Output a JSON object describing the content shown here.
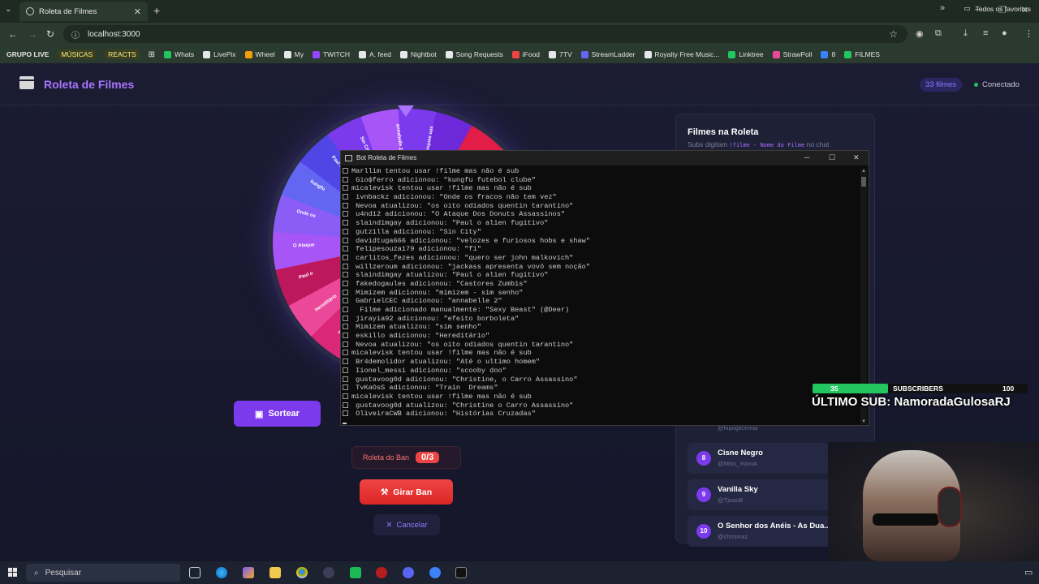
{
  "browser": {
    "tab_title": "Roleta de Filmes",
    "url": "localhost:3000",
    "bookmarks": [
      {
        "label": "GRUPO LIVE",
        "style": "bold"
      },
      {
        "label": "MÚSICAS",
        "style": "yellow"
      },
      {
        "label": "REACTS",
        "style": "yellow"
      },
      {
        "label": "",
        "style": "grid"
      },
      {
        "label": "Whats",
        "color": "#22c55e"
      },
      {
        "label": "LivePix",
        "color": "#e5e7eb"
      },
      {
        "label": "Wheel",
        "color": "#f59e0b"
      },
      {
        "label": "My",
        "color": "#e5e7eb"
      },
      {
        "label": "TWITCH",
        "color": "#9146ff"
      },
      {
        "label": "A. feed",
        "color": "#e5e7eb"
      },
      {
        "label": "Nightbot",
        "color": "#e5e7eb"
      },
      {
        "label": "Song Requests",
        "color": "#e5e7eb"
      },
      {
        "label": "iFood",
        "color": "#ef4444"
      },
      {
        "label": "7TV",
        "color": "#e5e7eb"
      },
      {
        "label": "StreamLadder",
        "color": "#6366f1"
      },
      {
        "label": "Royalty Free Music...",
        "color": "#e5e7eb"
      },
      {
        "label": "Linktree",
        "color": "#22c55e"
      },
      {
        "label": "StrawPoll",
        "color": "#ec4899"
      },
      {
        "label": "8",
        "color": "#3b82f6"
      },
      {
        "label": "FILMES",
        "color": "#22c55e"
      }
    ],
    "all_bookmarks": "Todos os favoritos"
  },
  "app": {
    "title": "Roleta de Filmes",
    "film_count": "33 filmes",
    "status": "Conectado",
    "sortear_label": "Sortear",
    "ban_label": "Roleta do Ban",
    "ban_count": "0/3",
    "girar_ban_label": "Girar Ban",
    "cancel_label": "Cancelar",
    "wheel_labels": [
      "sim senho",
      "annabelle 2",
      "Sin City",
      "Paul o",
      "kungfu",
      "Onde os",
      "O Ataque",
      "Paul o",
      "Hereditário",
      "o ultimo",
      "Sexy Beast",
      "scooby doo"
    ],
    "panel": {
      "title": "Filmes na Roleta",
      "subtitle_prefix": "Subs digitam",
      "command": "!filme - Nome do Filme",
      "subtitle_suffix": "no chat",
      "partial_user": "@hipoglicemia",
      "films": [
        {
          "num": "8",
          "name": "Cisne Negro",
          "user": "@Miss_YoonA"
        },
        {
          "num": "9",
          "name": "Vanilla Sky",
          "user": "@TjoaoB"
        },
        {
          "num": "10",
          "name": "O Senhor dos Anéis - As Dua...",
          "user": "@chrismxz"
        }
      ]
    }
  },
  "console": {
    "title": "Bot Roleta de Filmes",
    "lines": [
      "Marllim tentou usar !filme mas não é sub",
      " Gioфferro adicionou: \"kungfu futebol clube\"",
      "micalevisk tentou usar !filme mas não é sub",
      " ivnbackz adicionou: \"Onde os fracos não tem vez\"",
      " Nevoa atualizou: \"os oito odiados quentin tarantino\"",
      " u4nd12 adicionou: \"O Ataque Dos Donuts Assassinos\"",
      " slaindimgay adicionou: \"Paul o alien fugitivo\"",
      " gutz1lla adicionou: \"Sin City\"",
      " davidtuga666 adicionou: \"velozes e furiosos hobs e shaw\"",
      " felipesouza179 adicionou: \"f1\"",
      " carlitos_fezes adicionou: \"quero ser john malkovich\"",
      " willzeroum adicionou: \"jackass apresenta vovó sem noção\"",
      " slaindimgay atualizou: \"Paul o alien fugitivo\"",
      " fakedogaules adicionou: \"Castores Zumbis\"",
      " Mimizem adicionou: \"mimizem - sim senho\"",
      " GabrielCEC adicionou: \"annabelle 2\"",
      "  Filme adicionado manualmente: \"Sexy Beast\" (@Deer)",
      " jirayia92 adicionou: \"efeito borboleta\"",
      " Mimizem atualizou: \"sim senho\"",
      " eskillo adicionou: \"Hereditário\"",
      " Nevoa atualizou: \"os oito odiados quentin tarantino\"",
      "micalevisk tentou usar !filme mas não é sub",
      " Br4demolidor atualizou: \"Até o ultimo homem\"",
      " Iionel_messi adicionou: \"scooby doo\"",
      " gustavoog0d adicionou: \"Christine, o Carro Assassino\"",
      " TvKaOsS adicionou: \"Train  Dreams\"",
      "micalevisk tentou usar !filme mas não é sub",
      " gustavoog0d atualizou: \"Christine o Carro Assassino\"",
      " OliveiraCWB adicionou: \"Histórias Cruzadas\""
    ]
  },
  "overlay": {
    "sub_current": "35",
    "sub_label": "SUBSCRIBERS",
    "sub_goal": "100",
    "sub_progress": 0.35,
    "last_sub": "ÚLTIMO SUB: NamoradaGulosaRJ"
  },
  "taskbar": {
    "search_placeholder": "Pesquisar"
  },
  "colors": {
    "accent": "#a974ff",
    "danger": "#ef4444",
    "success": "#22c55e"
  }
}
